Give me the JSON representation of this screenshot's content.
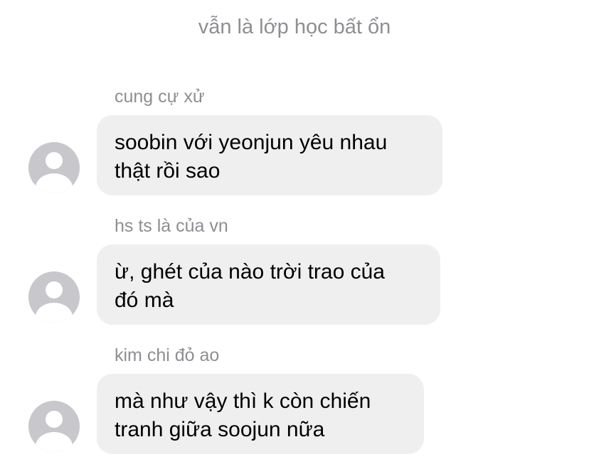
{
  "chat": {
    "title": "vẫn là lớp học bất ổn"
  },
  "messages": [
    {
      "sender": "cung cự xử",
      "lines": [
        "soobin với yeonjun yêu nhau",
        "thật rồi sao"
      ]
    },
    {
      "sender": "hs ts là của vn",
      "lines": [
        "ừ, ghét của nào trời trao của",
        "đó mà"
      ]
    },
    {
      "sender": "kim chi đỏ ao",
      "lines": [
        "mà như vậy thì k còn chiến",
        "tranh giữa soojun nữa"
      ]
    }
  ],
  "colors": {
    "bubble_bg": "#efeff0",
    "meta_text": "#8e8e93",
    "avatar_bg": "#c7c7cc"
  },
  "icons": {
    "avatar": "default-person-avatar"
  }
}
